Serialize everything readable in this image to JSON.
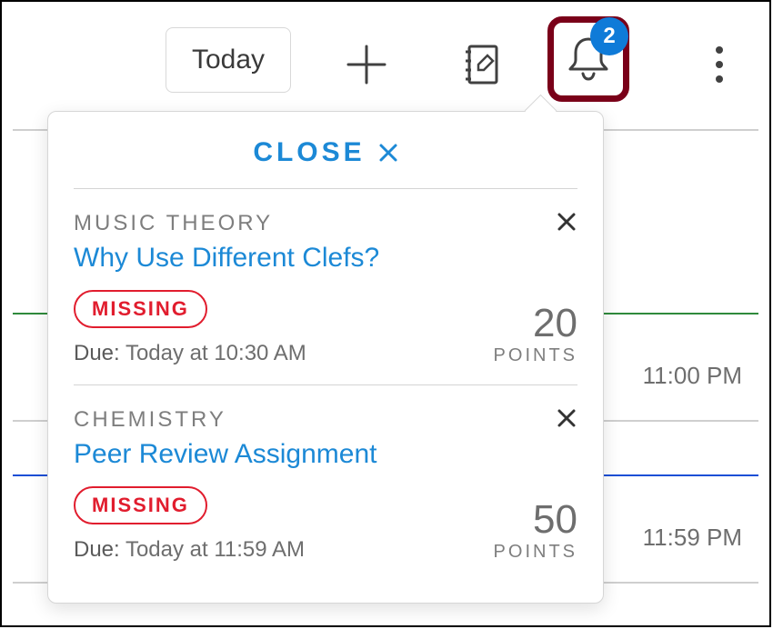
{
  "toolbar": {
    "today_label": "Today",
    "badge_count": "2"
  },
  "popover": {
    "close_label": "CLOSE",
    "items": [
      {
        "course": "MUSIC THEORY",
        "title": "Why Use Different Clefs?",
        "status": "MISSING",
        "due_label": "Due:",
        "due_value": "Today at 10:30 AM",
        "points_value": "20",
        "points_label": "POINTS"
      },
      {
        "course": "CHEMISTRY",
        "title": "Peer Review Assignment",
        "status": "MISSING",
        "due_label": "Due:",
        "due_value": "Today at 11:59 AM",
        "points_value": "50",
        "points_label": "POINTS"
      }
    ]
  },
  "background": {
    "row1_time": "11:00 PM",
    "row2_time": "11:59 PM",
    "row1_color": "#2f8a3c",
    "row2_color": "#1b4fd6"
  }
}
